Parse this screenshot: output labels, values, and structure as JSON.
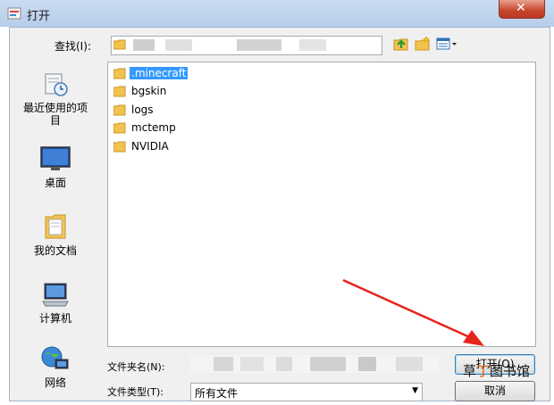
{
  "window": {
    "title": "打开",
    "close_glyph": "✕"
  },
  "toolbar": {
    "lookin_label": "查找(I):",
    "up_icon": "up-folder-icon",
    "new_folder_icon": "new-folder-icon",
    "view_menu_icon": "view-menu-icon"
  },
  "places": [
    {
      "label": "最近使用的项目",
      "icon": "recent-items-icon"
    },
    {
      "label": "桌面",
      "icon": "desktop-icon"
    },
    {
      "label": "我的文档",
      "icon": "documents-icon"
    },
    {
      "label": "计算机",
      "icon": "computer-icon"
    },
    {
      "label": "网络",
      "icon": "network-icon"
    }
  ],
  "files": [
    {
      "name": ".minecraft",
      "selected": true
    },
    {
      "name": "bgskin",
      "selected": false
    },
    {
      "name": "logs",
      "selected": false
    },
    {
      "name": "mctemp",
      "selected": false
    },
    {
      "name": "NVIDIA",
      "selected": false
    }
  ],
  "fields": {
    "filename_label": "文件夹名(N):",
    "filetype_label": "文件类型(T):",
    "filetype_value": "所有文件"
  },
  "buttons": {
    "open": "打开(O)",
    "cancel": "取消"
  },
  "watermark": {
    "prefix": "草",
    "highlight": "丁",
    "suffix": "图书馆"
  },
  "colors": {
    "selection": "#3399ff",
    "annotation_arrow": "#e8231c"
  }
}
